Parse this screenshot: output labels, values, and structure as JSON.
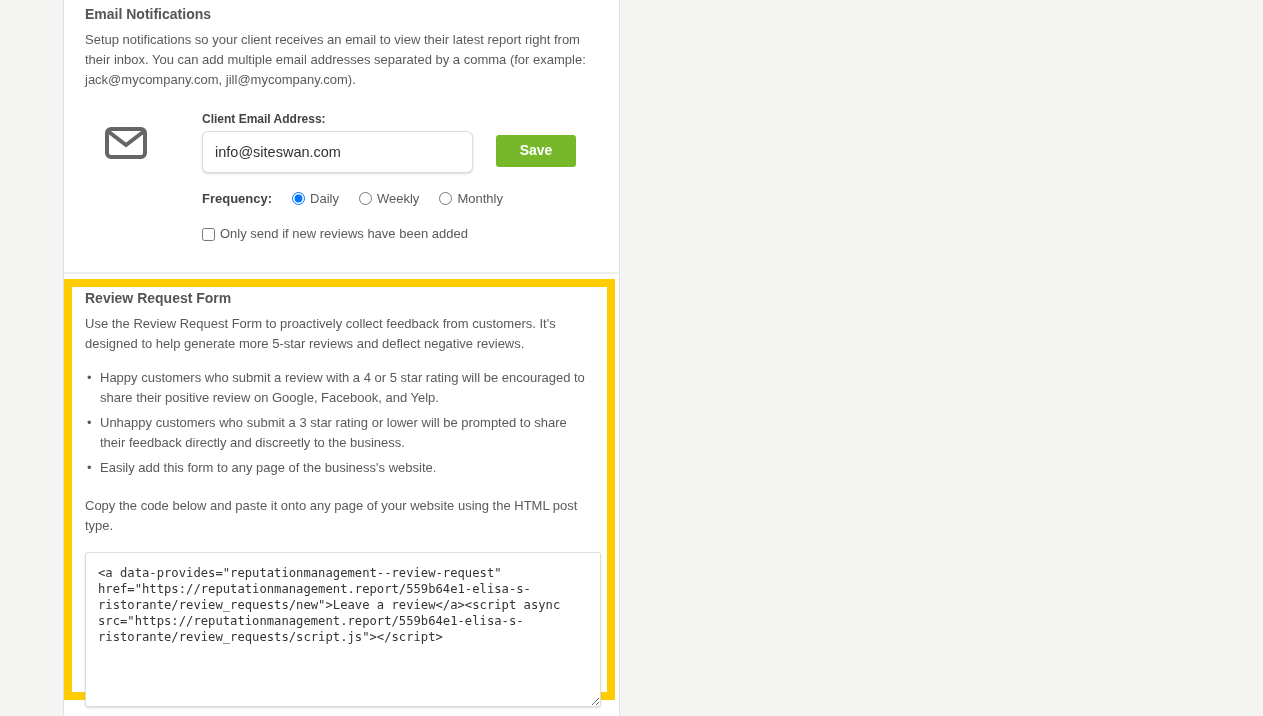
{
  "email_notifications": {
    "title": "Email Notifications",
    "description": "Setup notifications so your client receives an email to view their latest report right from their inbox. You can add multiple email addresses separated by a comma (for example: jack@mycompany.com, jill@mycompany.com).",
    "client_email": {
      "label": "Client Email Address:",
      "value": "info@siteswan.com"
    },
    "save_button": "Save",
    "frequency": {
      "label": "Frequency:",
      "options": [
        {
          "label": "Daily",
          "selected": true
        },
        {
          "label": "Weekly",
          "selected": false
        },
        {
          "label": "Monthly",
          "selected": false
        }
      ]
    },
    "only_new_reviews": {
      "label": "Only send if new reviews have been added",
      "checked": false
    }
  },
  "review_request_form": {
    "highlighted": true,
    "title": "Review Request Form",
    "description": "Use the Review Request Form to proactively collect feedback from customers. It's designed to help generate more 5-star reviews and deflect negative reviews.",
    "bullets": [
      {
        "marker": "•",
        "text": "Happy customers who submit a review with a 4 or 5 star rating will be encouraged to share their positive review on Google, Facebook, and Yelp."
      },
      {
        "marker": "•",
        "text": "Unhappy customers who submit a 3 star rating or lower will be prompted to share their feedback directly and discreetly to the business."
      },
      {
        "marker": "•",
        "text": "Easily add this form to any page of the business's website."
      }
    ],
    "instructions": "Copy the code below and paste it onto any page of your website using the HTML post type.",
    "code": "<a data-provides=\"reputationmanagement--review-request\" href=\"https://reputationmanagement.report/559b64e1-elisa-s-ristorante/review_requests/new\">Leave a review</a><script async src=\"https://reputationmanagement.report/559b64e1-elisa-s-ristorante/review_requests/script.js\"></script>"
  }
}
